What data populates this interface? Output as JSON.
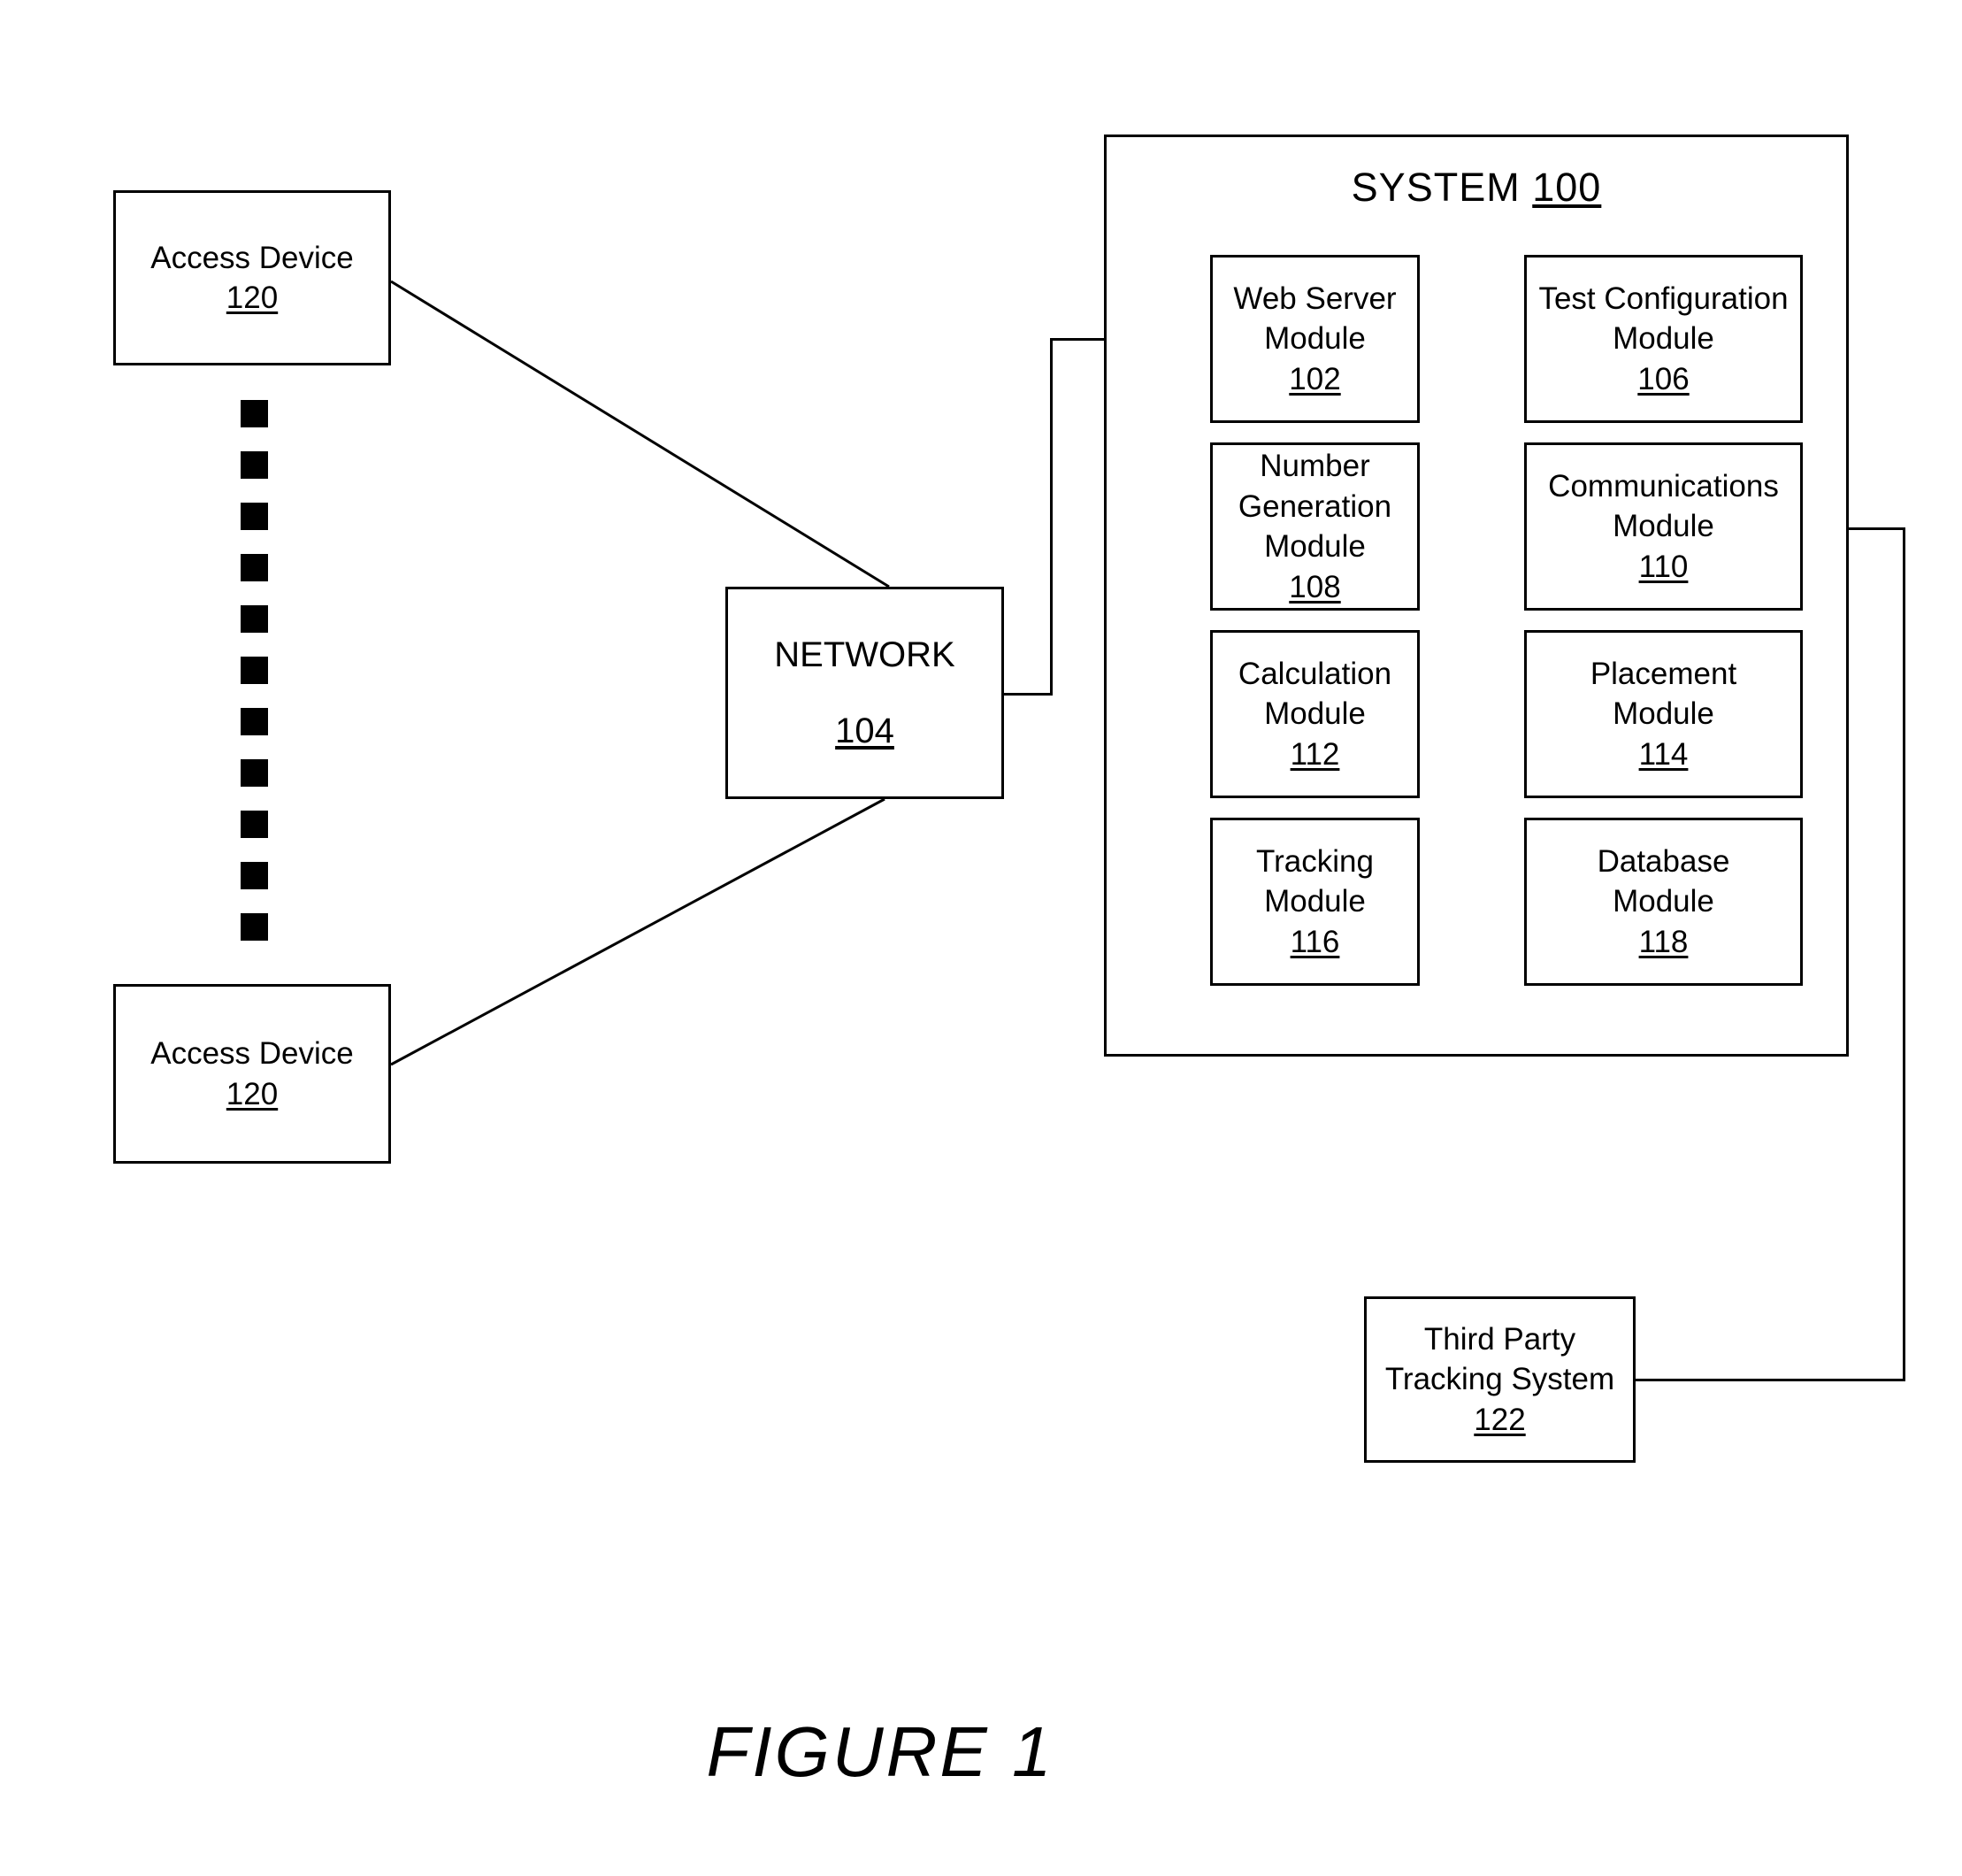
{
  "figure": {
    "caption": "FIGURE 1"
  },
  "system": {
    "title_text": "SYSTEM",
    "title_number": "100"
  },
  "access_devices": [
    {
      "label": "Access Device",
      "number": "120"
    },
    {
      "label": "Access Device",
      "number": "120"
    }
  ],
  "network": {
    "label": "NETWORK",
    "number": "104"
  },
  "third_party": {
    "line1": "Third Party",
    "line2": "Tracking System",
    "number": "122"
  },
  "modules": [
    {
      "line1": "Web Server",
      "line2": "Module",
      "line3": "",
      "number": "102"
    },
    {
      "line1": "Test Configuration",
      "line2": "Module",
      "line3": "",
      "number": "106"
    },
    {
      "line1": "Number",
      "line2": "Generation",
      "line3": "Module",
      "number": "108"
    },
    {
      "line1": "Communications",
      "line2": "Module",
      "line3": "",
      "number": "110"
    },
    {
      "line1": "Calculation",
      "line2": "Module",
      "line3": "",
      "number": "112"
    },
    {
      "line1": "Placement",
      "line2": "Module",
      "line3": "",
      "number": "114"
    },
    {
      "line1": "Tracking",
      "line2": "Module",
      "line3": "",
      "number": "116"
    },
    {
      "line1": "Database",
      "line2": "Module",
      "line3": "",
      "number": "118"
    }
  ],
  "ellipsis": {
    "name": "vertical-dashed-ellipsis",
    "count": 11
  },
  "colors": {
    "stroke": "#000000",
    "background": "#ffffff"
  }
}
